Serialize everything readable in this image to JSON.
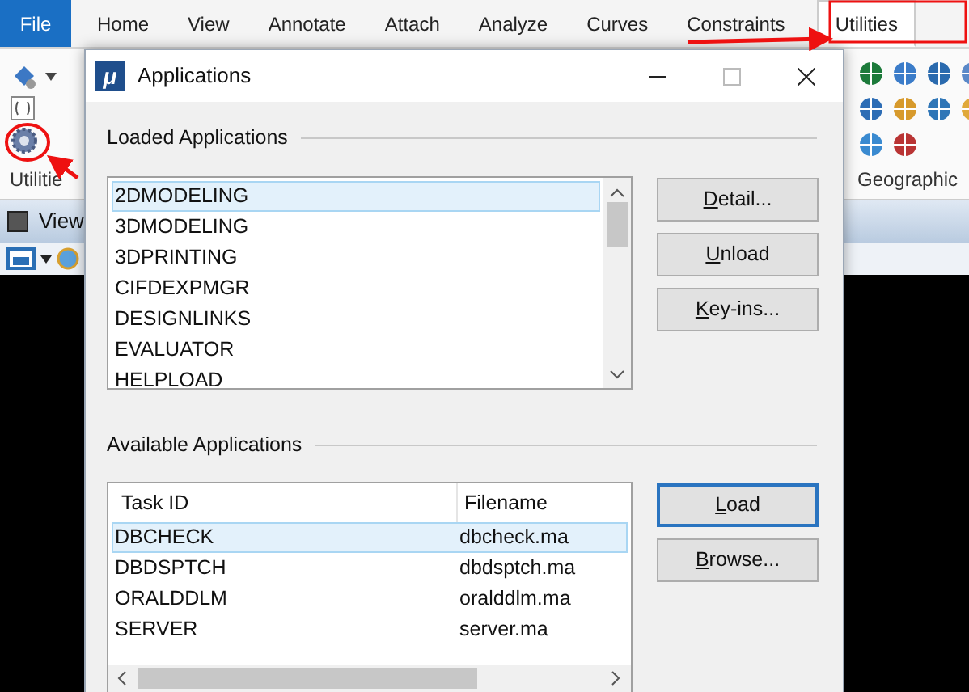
{
  "ribbon": {
    "tabs": [
      {
        "label": "File",
        "kind": "file",
        "selected": false
      },
      {
        "label": "Home",
        "kind": "tab",
        "selected": false
      },
      {
        "label": "View",
        "kind": "tab",
        "selected": false
      },
      {
        "label": "Annotate",
        "kind": "tab",
        "selected": false
      },
      {
        "label": "Attach",
        "kind": "tab",
        "selected": false
      },
      {
        "label": "Analyze",
        "kind": "tab",
        "selected": false
      },
      {
        "label": "Curves",
        "kind": "tab",
        "selected": false
      },
      {
        "label": "Constraints",
        "kind": "tab",
        "selected": false
      },
      {
        "label": "Utilities",
        "kind": "tab",
        "selected": true
      }
    ],
    "left_group_label": "Utilitie",
    "right_group_label": "Geographic"
  },
  "view_bar": {
    "title": "View"
  },
  "dialog": {
    "title": "Applications",
    "app_icon": "μ",
    "loaded": {
      "label": "Loaded Applications",
      "items": [
        {
          "text": "2DMODELING",
          "selected": true
        },
        {
          "text": "3DMODELING",
          "selected": false
        },
        {
          "text": "3DPRINTING",
          "selected": false
        },
        {
          "text": "CIFDEXPMGR",
          "selected": false
        },
        {
          "text": "DESIGNLINKS",
          "selected": false
        },
        {
          "text": "EVALUATOR",
          "selected": false
        },
        {
          "text": "HELPLOAD",
          "selected": false
        }
      ],
      "buttons": [
        {
          "label": "Detail...",
          "mnemonic_underlined": true,
          "focused": false
        },
        {
          "label": "Unload",
          "mnemonic_underlined": true,
          "focused": false
        },
        {
          "label": "Key-ins...",
          "mnemonic_underlined": true,
          "focused": false
        }
      ]
    },
    "available": {
      "label": "Available Applications",
      "columns": [
        "Task ID",
        "Filename"
      ],
      "rows": [
        {
          "cells": [
            "DBCHECK",
            "dbcheck.ma"
          ],
          "selected": true
        },
        {
          "cells": [
            "DBDSPTCH",
            "dbdsptch.ma"
          ],
          "selected": false
        },
        {
          "cells": [
            "ORALDDLM",
            "oralddlm.ma"
          ],
          "selected": false
        },
        {
          "cells": [
            "SERVER",
            "server.ma"
          ],
          "selected": false
        }
      ],
      "buttons": [
        {
          "label": "Load",
          "mnemonic_underlined": true,
          "focused": true
        },
        {
          "label": "Browse...",
          "mnemonic_underlined": true,
          "focused": false
        }
      ]
    }
  }
}
